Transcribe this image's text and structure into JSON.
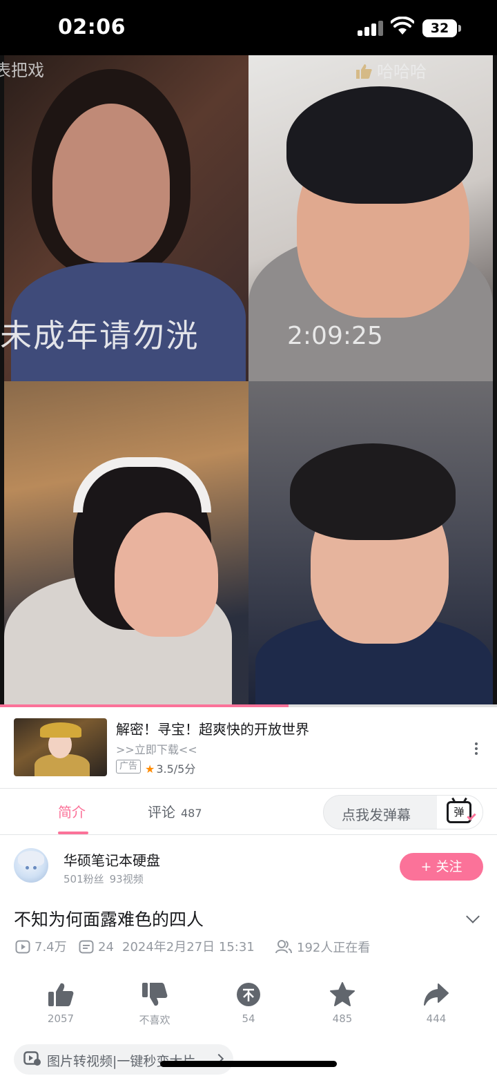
{
  "status_bar": {
    "time": "02:06",
    "battery": "32"
  },
  "video": {
    "overlays": {
      "top_left": "表把戏",
      "top_right_thumb": "哈哈哈",
      "left_big": "未成年请勿洸",
      "timestamp": "2:09:25"
    },
    "progress_fraction": 0.58
  },
  "ad": {
    "title": "解密！寻宝！超爽快的开放世界",
    "subtitle": ">>立即下载<<",
    "tag": "广告",
    "rating": "3.5/5分"
  },
  "tabs": {
    "intro_label": "简介",
    "comments_label": "评论",
    "comments_count": "487",
    "danmaku_placeholder": "点我发弹幕",
    "danmaku_button": "弹"
  },
  "uploader": {
    "name": "华硕笔记本硬盘",
    "fans": "501粉丝",
    "videos": "93视频",
    "follow_label": "+ 关注"
  },
  "video_info": {
    "title": "不知为何面露难色的四人",
    "views": "7.4万",
    "danmaku_count": "24",
    "date": "2024年2月27日 15:31",
    "watching": "192人正在看"
  },
  "actions": {
    "like": "2057",
    "dislike": "不喜欢",
    "coin": "54",
    "favorite": "485",
    "share": "444"
  },
  "promo": {
    "label": "图片转视频|一键秒变大片"
  },
  "colors": {
    "accent": "#fb7299",
    "muted": "#9499a0"
  }
}
